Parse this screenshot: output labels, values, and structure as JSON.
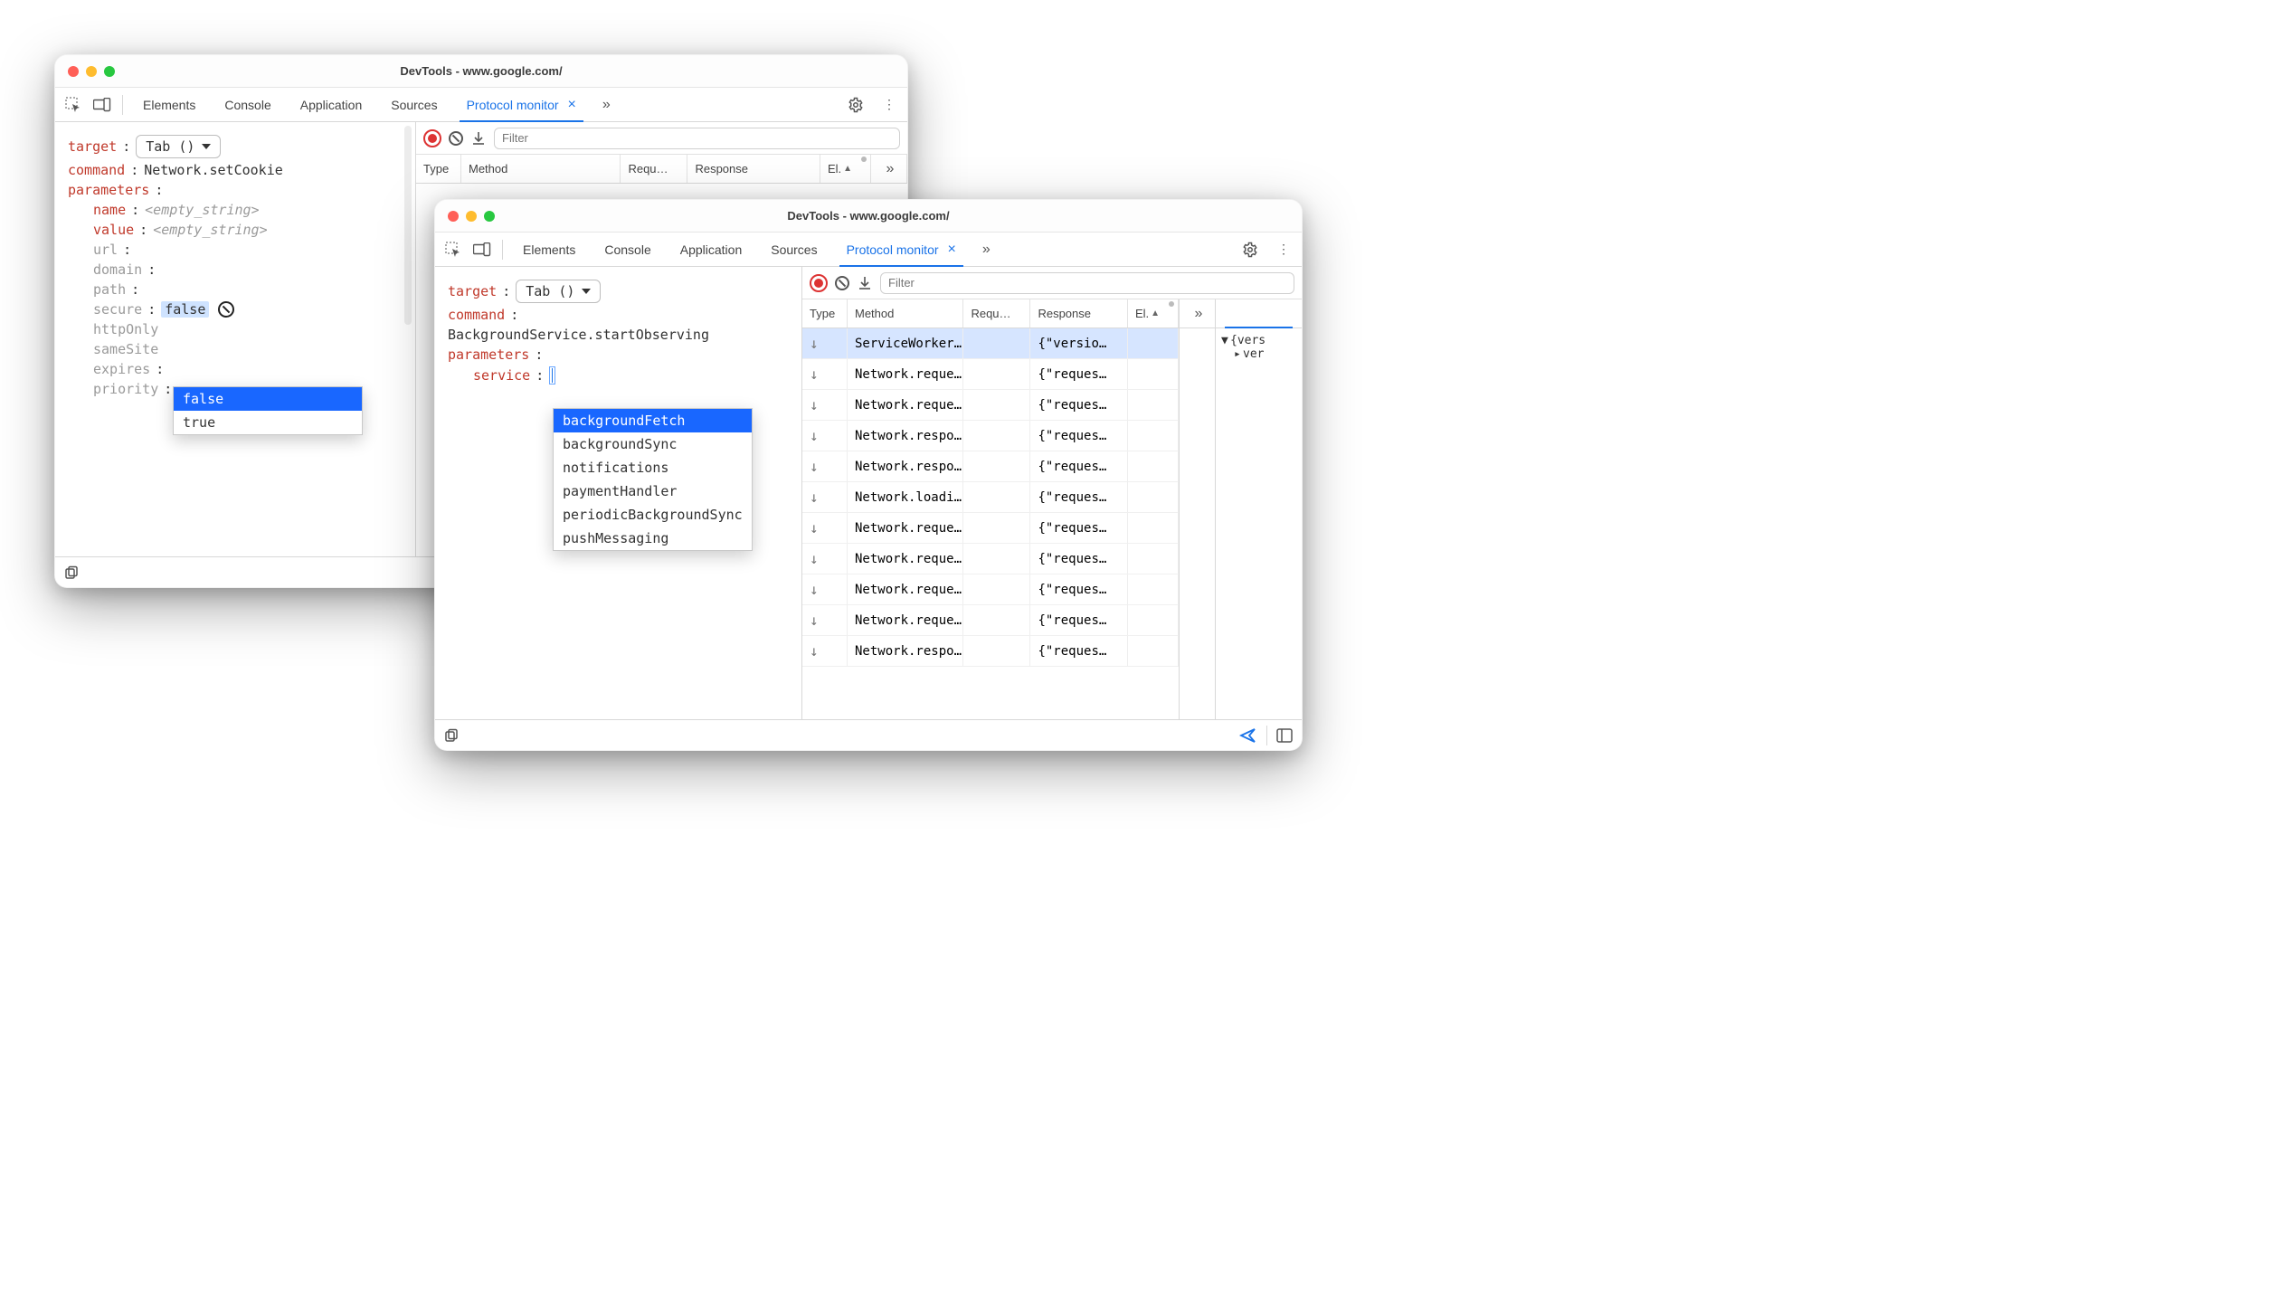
{
  "common": {
    "title_prefix": "DevTools - ",
    "url": "www.google.com/",
    "tabs": {
      "elements": "Elements",
      "console": "Console",
      "application": "Application",
      "sources": "Sources",
      "protocol_monitor": "Protocol monitor"
    },
    "filter_placeholder": "Filter",
    "columns": {
      "type": "Type",
      "method": "Method",
      "request": "Requ…",
      "response": "Response",
      "elapsed": "El."
    }
  },
  "windowA": {
    "left": {
      "target_key": "target",
      "target_value": "Tab ()",
      "command_key": "command",
      "command_value": "Network.setCookie",
      "parameters_key": "parameters",
      "params": {
        "name": "name",
        "name_val": "<empty_string>",
        "value": "value",
        "value_val": "<empty_string>",
        "url": "url",
        "domain": "domain",
        "path": "path",
        "secure": "secure",
        "secure_val": "false",
        "httpOnly": "httpOnly",
        "sameSite": "sameSite",
        "expires": "expires",
        "priority": "priority"
      },
      "autocomplete": [
        "false",
        "true"
      ],
      "ac_selected_index": 0
    }
  },
  "windowB": {
    "left": {
      "target_key": "target",
      "target_value": "Tab ()",
      "command_key": "command",
      "command_value": "BackgroundService.startObserving",
      "parameters_key": "parameters",
      "param_key": "service",
      "autocomplete": [
        "backgroundFetch",
        "backgroundSync",
        "notifications",
        "paymentHandler",
        "periodicBackgroundSync",
        "pushMessaging"
      ],
      "ac_selected_index": 0
    },
    "rows": [
      {
        "method": "ServiceWorker…",
        "response": "{\"versio…",
        "selected": true
      },
      {
        "method": "Network.reque…",
        "response": "{\"reques…"
      },
      {
        "method": "Network.reque…",
        "response": "{\"reques…"
      },
      {
        "method": "Network.respo…",
        "response": "{\"reques…"
      },
      {
        "method": "Network.respo…",
        "response": "{\"reques…"
      },
      {
        "method": "Network.loadi…",
        "response": "{\"reques…"
      },
      {
        "method": "Network.reque…",
        "response": "{\"reques…"
      },
      {
        "method": "Network.reque…",
        "response": "{\"reques…"
      },
      {
        "method": "Network.reque…",
        "response": "{\"reques…"
      },
      {
        "method": "Network.reque…",
        "response": "{\"reques…"
      },
      {
        "method": "Network.respo…",
        "response": "{\"reques…"
      }
    ],
    "detail": {
      "root": "{vers",
      "child": "ver"
    }
  }
}
